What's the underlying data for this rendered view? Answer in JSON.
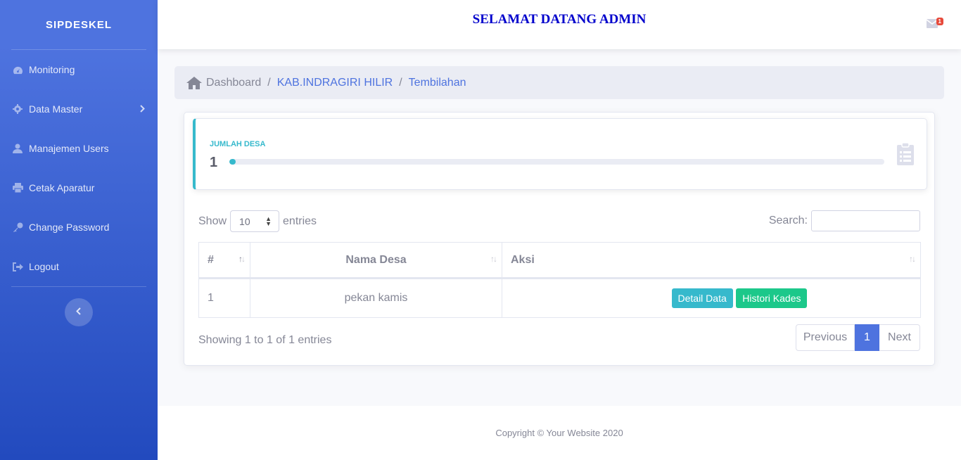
{
  "sidebar": {
    "brand": "SIPDESKEL",
    "items": [
      {
        "label": "Monitoring",
        "icon": "dashboard-icon"
      },
      {
        "label": "Data Master",
        "icon": "gear-icon"
      },
      {
        "label": "Manajemen Users",
        "icon": "user-icon"
      },
      {
        "label": "Cetak Aparatur",
        "icon": "printer-icon"
      },
      {
        "label": "Change Password",
        "icon": "key-icon"
      },
      {
        "label": "Logout",
        "icon": "logout-icon"
      }
    ]
  },
  "topbar": {
    "title": "SELAMAT DATANG ADMIN",
    "message_count": "1"
  },
  "breadcrumb": {
    "items": [
      "Dashboard",
      "KAB.INDRAGIRI HILIR",
      "Tembilahan"
    ]
  },
  "stat": {
    "label": "JUMLAH DESA",
    "value": "1",
    "progress_fraction": 0.01
  },
  "table": {
    "show_label": "Show",
    "page_size": "10",
    "entries_label": "entries",
    "search_label": "Search:",
    "columns": [
      "#",
      "Nama Desa",
      "Aksi"
    ],
    "rows": [
      {
        "no": "1",
        "nama_desa": "pekan kamis",
        "detail_label": "Detail Data",
        "histori_label": "Histori Kades"
      }
    ],
    "info": "Showing 1 to 1 of 1 entries",
    "pagination": {
      "previous": "Previous",
      "current": "1",
      "next": "Next"
    }
  },
  "footer": {
    "text": "Copyright © Your Website 2020"
  },
  "colors": {
    "primary": "#4e73df",
    "info": "#36b9cc",
    "success": "#1cc88a",
    "danger": "#e74a3b",
    "title": "#0000cc"
  }
}
